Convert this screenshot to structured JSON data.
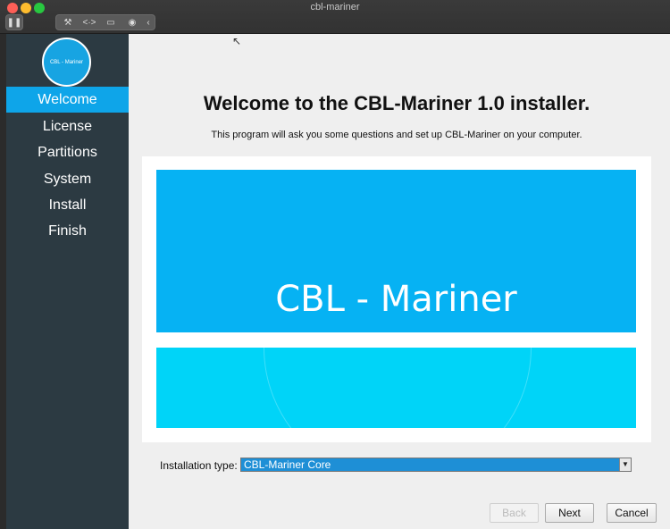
{
  "window": {
    "title": "cbl-mariner"
  },
  "toolbar": {
    "pause_icon": "pause-icon",
    "wrench_icon": "wrench-icon",
    "code_icon": "code-icon",
    "drive_icon": "drive-icon",
    "user_icon": "user-icon",
    "chevron_icon": "chevron-left-icon"
  },
  "sidebar": {
    "logo_text": "CBL - Mariner",
    "items": [
      {
        "label": "Welcome",
        "active": true
      },
      {
        "label": "License",
        "active": false
      },
      {
        "label": "Partitions",
        "active": false
      },
      {
        "label": "System",
        "active": false
      },
      {
        "label": "Install",
        "active": false
      },
      {
        "label": "Finish",
        "active": false
      }
    ]
  },
  "main": {
    "title": "Welcome to the CBL-Mariner 1.0 installer.",
    "subtitle": "This program will ask you some questions and set up CBL-Mariner on your computer.",
    "banner_text": "CBL - Mariner",
    "installation_type_label": "Installation type:",
    "installation_type_value": "CBL-Mariner Core"
  },
  "buttons": {
    "back": "Back",
    "next": "Next",
    "cancel": "Cancel"
  },
  "colors": {
    "sidebar_bg": "#2c3a42",
    "accent": "#0ea5e9",
    "banner_top": "#06b2f3",
    "banner_bottom": "#00d4f8"
  }
}
